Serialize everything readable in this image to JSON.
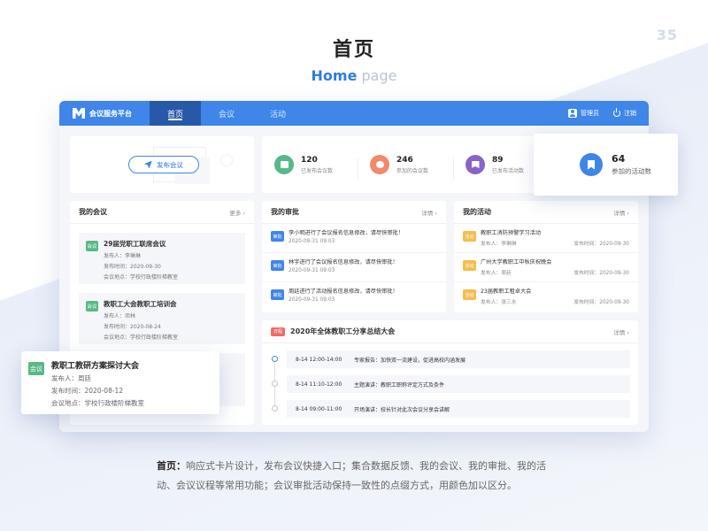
{
  "page_number": "35",
  "hero": {
    "title": "首页",
    "subtitle_en": "Home",
    "subtitle_en2": "page"
  },
  "nav": {
    "logo": "会议服务平台",
    "tabs": [
      "首页",
      "会议",
      "活动"
    ],
    "user": "管理员",
    "logout": "注销",
    "accent": "#3f86e8"
  },
  "publish": {
    "label": "发布会议"
  },
  "stats": [
    {
      "num": "120",
      "label": "已发布会议数",
      "color": "#57b987"
    },
    {
      "num": "246",
      "label": "参加的会议数",
      "color": "#f08a6a"
    },
    {
      "num": "89",
      "label": "已发布活动数",
      "color": "#8a63c8"
    }
  ],
  "pop_stat": {
    "num": "64",
    "label": "参加的活动数"
  },
  "meetings": {
    "title": "我的会议",
    "more": "更多 ›",
    "tag": "会议",
    "items": [
      {
        "title": "29届党职工联席会议",
        "publisher": "发布人：李琳琳",
        "time": "发布时间：2020-09-30",
        "place": "会议地点：学校行政楼阶梯教室"
      },
      {
        "title": "教职工大会教职工培训会",
        "publisher": "发布人：邓林",
        "time": "发布时间：2020-08-24",
        "place": "会议地点：学校行政楼阶梯教室"
      }
    ]
  },
  "pop_meeting": {
    "tag": "会议",
    "title": "教职工教研方案探讨大会",
    "publisher": "发布人：周廷",
    "time": "发布时间：2020-08-12",
    "place": "会议地点：学校行政楼阶梯教室"
  },
  "approvals": {
    "title": "我的审批",
    "more": "详情 ›",
    "tag": "审批",
    "items": [
      {
        "title": "李小明进行了会议报名信息修改，请尽快审批！",
        "time": "2020-09-31 09:03"
      },
      {
        "title": "林宇进行了会议报名信息修改，请尽快审批！",
        "time": "2020-09-31 09:03"
      },
      {
        "title": "周廷进行了活动报名信息修改，请尽快审批！",
        "time": "2020-09-31 09:03"
      }
    ]
  },
  "activities": {
    "title": "我的活动",
    "more": "详情 ›",
    "tag": "活动",
    "items": [
      {
        "title": "教职工消防预警学习活动",
        "publisher": "发布人：李琳琳",
        "time": "发布时间：2020-09-30"
      },
      {
        "title": "广州大学教职工中秋庆祝晚会",
        "publisher": "发布人：周廷",
        "time": "发布时间：2020-09-30"
      },
      {
        "title": "23届教职工租卓大会",
        "publisher": "发布人：张三水",
        "time": "发布时间：2020-09-30"
      }
    ]
  },
  "summary": {
    "tag": "日程",
    "title": "2020年全体教职工分享总结大会",
    "more": "详情 ›",
    "rows": [
      {
        "time": "8-14 12:00-14:00",
        "text": "专家报告：加快双一流建设，促进高校内涵发展"
      },
      {
        "time": "8-14 11:10-12:00",
        "text": "主题演讲：教职工职称评定方式及条件"
      },
      {
        "time": "8-14 09:00-11:00",
        "text": "开场演讲：校长针对此次会议分享会讲解"
      }
    ]
  },
  "caption": {
    "bold": "首页：",
    "text": "响应式卡片设计，发布会议快捷入口；集合数据反馈、我的会议、我的审批、我的活动、会议议程等常用功能；会议审批活动保持一致性的点缀方式，用颜色加以区分。"
  }
}
